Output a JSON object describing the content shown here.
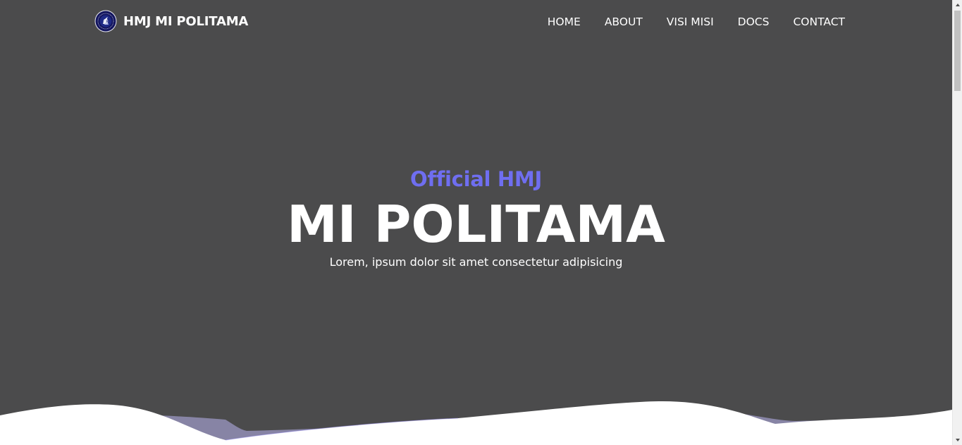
{
  "brand": {
    "title": "HMJ MI POLITAMA",
    "logo_icon": "hmj-emblem-icon"
  },
  "nav": {
    "items": [
      {
        "label": "HOME"
      },
      {
        "label": "ABOUT"
      },
      {
        "label": "VISI MISI"
      },
      {
        "label": "DOCS"
      },
      {
        "label": "CONTACT"
      }
    ]
  },
  "hero": {
    "subtitle": "Official HMJ",
    "title": "MI POLITAMA",
    "description": "Lorem, ipsum dolor sit amet consectetur adipisicing"
  },
  "colors": {
    "hero_background": "#4b4b4c",
    "accent": "#6f6ef0",
    "text": "#ffffff",
    "wave": "#ffffff"
  }
}
